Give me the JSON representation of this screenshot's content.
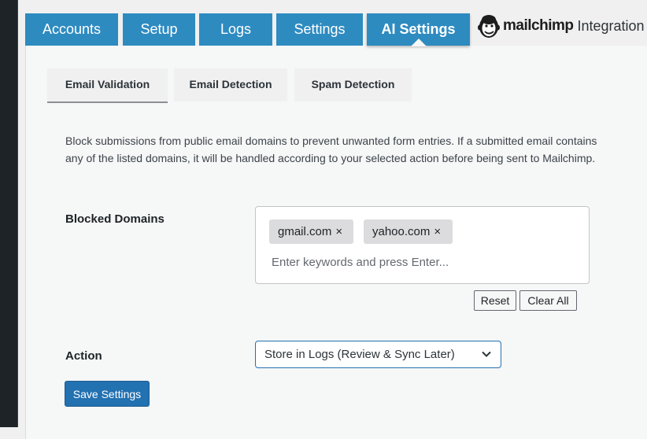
{
  "top_tabs": [
    {
      "label": "Accounts"
    },
    {
      "label": "Setup"
    },
    {
      "label": "Logs"
    },
    {
      "label": "Settings"
    },
    {
      "label": "AI Settings",
      "active": true
    }
  ],
  "brand": {
    "logo_icon": "mailchimp-freddie-icon",
    "name": "mailchimp",
    "suffix": "Integration"
  },
  "sub_tabs": [
    {
      "label": "Email Validation",
      "active": true
    },
    {
      "label": "Email Detection"
    },
    {
      "label": "Spam Detection"
    }
  ],
  "description": "Block submissions from public email domains to prevent unwanted form entries. If a submitted email contains any of the listed domains, it will be handled according to your selected action before being sent to Mailchimp.",
  "blocked_domains": {
    "label": "Blocked Domains",
    "tags": [
      "gmail.com",
      "yahoo.com"
    ],
    "remove_glyph": "×",
    "input_placeholder": "Enter keywords and press Enter...",
    "reset_label": "Reset",
    "clear_all_label": "Clear All"
  },
  "action": {
    "label": "Action",
    "selected": "Store in Logs (Review & Sync Later)",
    "icon": "chevron-down-icon"
  },
  "save_label": "Save Settings",
  "colors": {
    "tab_blue": "#2e8bc0",
    "primary_button": "#2271b1",
    "panel_bg": "#f6f7f7",
    "admin_bar": "#1d2327"
  }
}
